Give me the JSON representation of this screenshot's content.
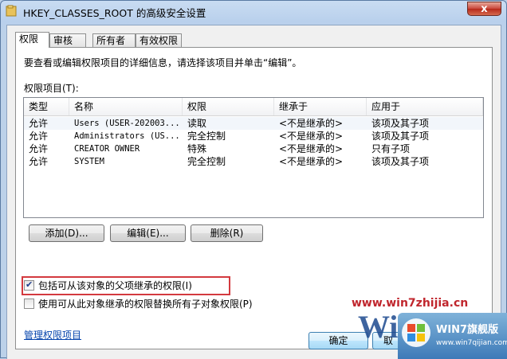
{
  "window": {
    "title": "HKEY_CLASSES_ROOT 的高级安全设置",
    "close_label": "x"
  },
  "tabs": [
    {
      "label": "权限"
    },
    {
      "label": "审核"
    },
    {
      "label": "所有者"
    },
    {
      "label": "有效权限"
    }
  ],
  "instruction": "要查看或编辑权限项目的详细信息，请选择该项目并单击“编辑”。",
  "list_label": "权限项目(T):",
  "columns": [
    "类型",
    "名称",
    "权限",
    "继承于",
    "应用于"
  ],
  "rows": [
    {
      "type": "允许",
      "name": "Users (USER-202003...",
      "permission": "读取",
      "inherited": "<不是继承的>",
      "applies": "该项及其子项"
    },
    {
      "type": "允许",
      "name": "Administrators (US...",
      "permission": "完全控制",
      "inherited": "<不是继承的>",
      "applies": "该项及其子项"
    },
    {
      "type": "允许",
      "name": "CREATOR OWNER",
      "permission": "特殊",
      "inherited": "<不是继承的>",
      "applies": "只有子项"
    },
    {
      "type": "允许",
      "name": "SYSTEM",
      "permission": "完全控制",
      "inherited": "<不是继承的>",
      "applies": "该项及其子项"
    }
  ],
  "buttons": {
    "add": "添加(D)...",
    "edit": "编辑(E)...",
    "remove": "删除(R)",
    "ok": "确定",
    "cancel": "取"
  },
  "checkboxes": {
    "inherit": {
      "label": "包括可从该对象的父项继承的权限(I)",
      "checked": true
    },
    "replace": {
      "label": "使用可从此对象继承的权限替换所有子对象权限(P)",
      "checked": false
    }
  },
  "link": "管理权限项目",
  "watermark": {
    "url": "www.win7zhijia.cn",
    "big": "Win",
    "logo_title": "WIN7旗舰版",
    "logo_sub": "www.win7qijian.com"
  }
}
